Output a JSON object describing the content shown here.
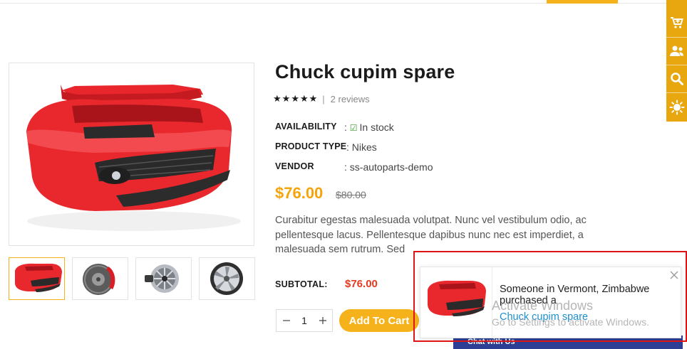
{
  "colors": {
    "accent": "#f5b21b",
    "toolbar": "#e8a60f",
    "price": "#f5a40b",
    "subtotal": "#e6391f",
    "link": "#1d8fcf",
    "highlight": "#e01414"
  },
  "toolbar": {
    "icons": [
      "cart-add-icon",
      "users-icon",
      "search-icon",
      "brightness-icon"
    ]
  },
  "product": {
    "title": "Chuck cupim spare",
    "rating": 5,
    "reviews": "2 reviews",
    "availability_label": "AVAILABILITY",
    "availability_sep": ":",
    "availability_value": "In stock",
    "type_label": "PRODUCT TYPE",
    "type_value": ": Nikes",
    "vendor_label": "VENDOR",
    "vendor_value": ": ss-autoparts-demo",
    "price": "$76.00",
    "old_price": "$80.00",
    "description": "Curabitur egestas malesuada volutpat. Nunc vel vestibulum odio, ac pellentesque lacus. Pellentesque dapibus nunc nec est imperdiet, a malesuada sem rutrum. Sed",
    "subtotal_label": "SUBTOTAL:",
    "subtotal_value": "$76.00",
    "qty_value": "1",
    "add_to_cart": "Add To Cart",
    "thumbnails": [
      "red bumper",
      "brake disc",
      "alternator",
      "alloy wheel"
    ]
  },
  "popup": {
    "message": "Someone in Vermont, Zimbabwe purchased a",
    "product_link": "Chuck cupim spare"
  },
  "chat": {
    "label": "Chat with Us"
  },
  "watermark": {
    "title": "Activate Windows",
    "subtitle": "Go to Settings to activate Windows."
  }
}
